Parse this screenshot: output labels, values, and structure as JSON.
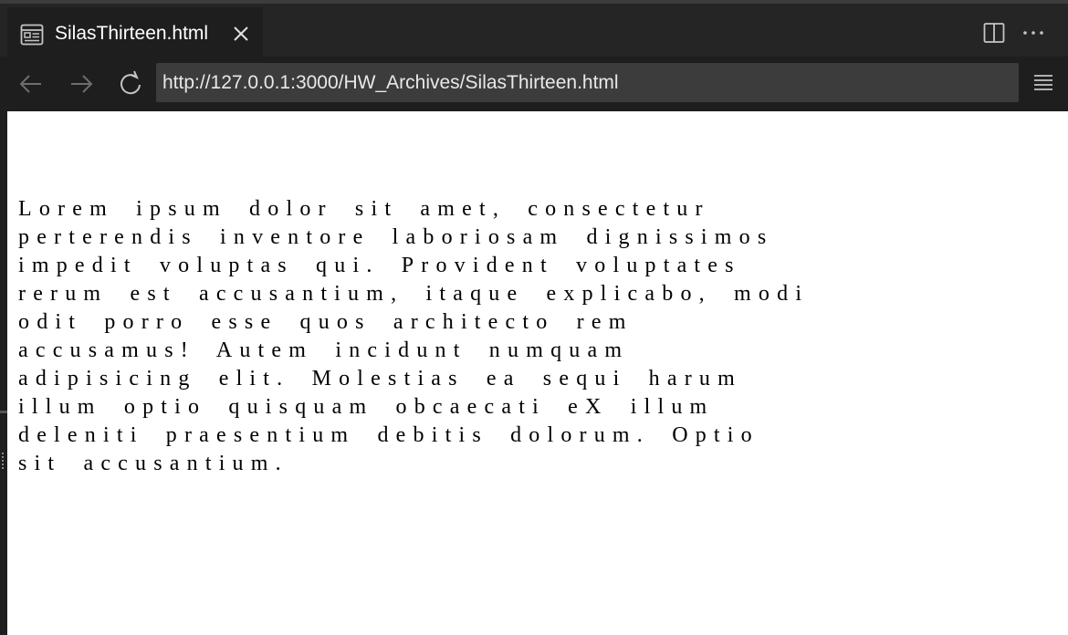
{
  "tab": {
    "title": "SilasThirteen.html",
    "icon": "preview-page-icon",
    "close_icon": "close-icon"
  },
  "toolbar": {
    "split_icon": "split-editor-icon",
    "more_icon": "more-actions-icon"
  },
  "nav": {
    "back_icon": "arrow-left-icon",
    "forward_icon": "arrow-right-icon",
    "reload_icon": "reload-icon",
    "url": "http://127.0.0.1:3000/HW_Archives/SilasThirteen.html",
    "menu_icon": "menu-icon"
  },
  "page": {
    "lines": [
      "Lorem ipsum dolor sit amet, consectetur",
      "perterendis inventore laboriosam dignissimos",
      "impedit voluptas qui. Provident voluptates",
      "rerum est accusantium, itaque explicabo, modi",
      "odit porro esse quos architecto rem",
      "accusamus! Autem incidunt numquam",
      "adipisicing elit. Molestias ea sequi harum",
      "illum optio quisquam obcaecati eX illum",
      "deleniti praesentium debitis dolorum. Optio",
      "sit accusantium."
    ]
  },
  "colors": {
    "tab_bar": "#252526",
    "active_tab": "#1e1e1e",
    "address_bar": "#3c3c3c",
    "page_background": "#ffffff"
  }
}
